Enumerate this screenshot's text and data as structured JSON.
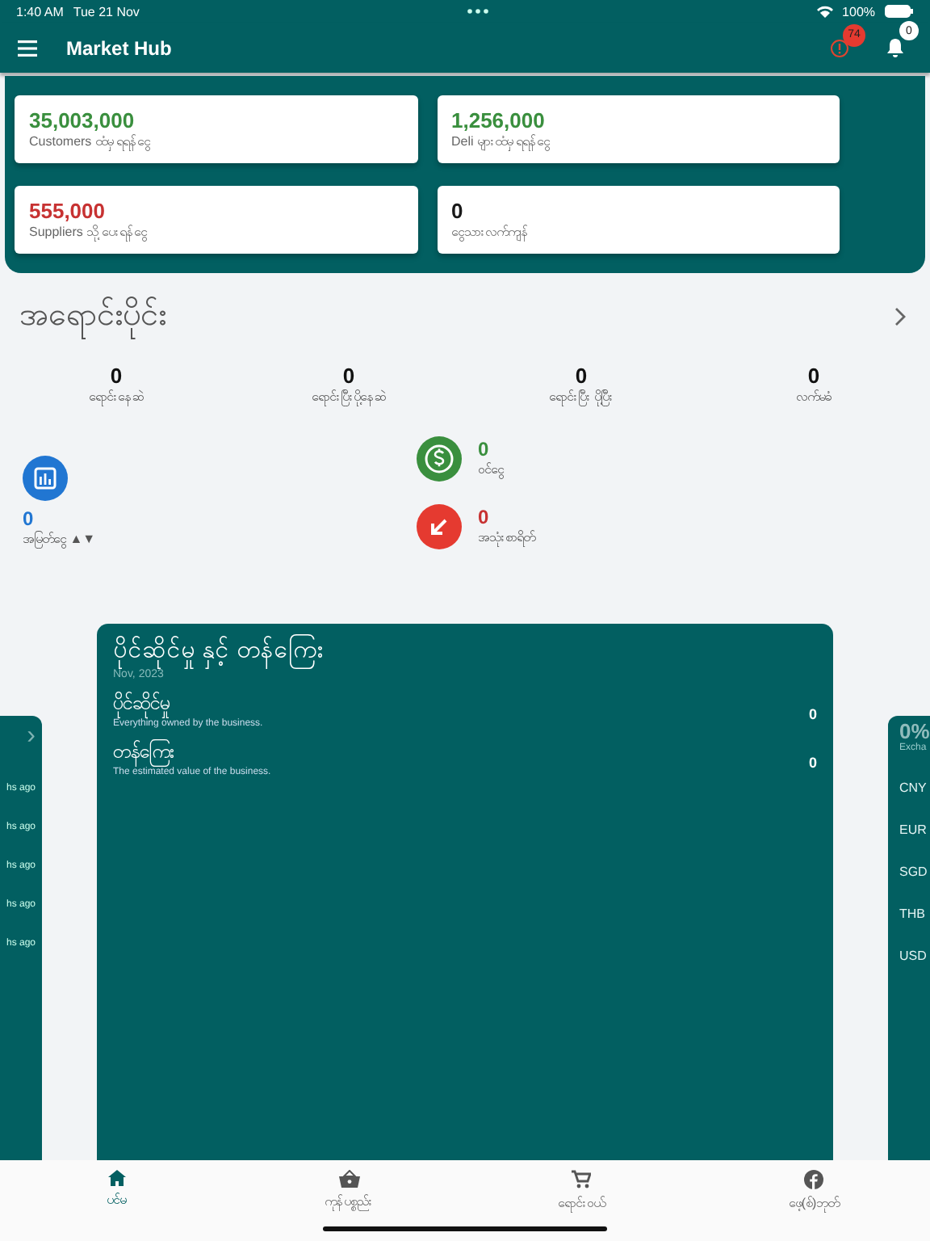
{
  "status_bar": {
    "time": "1:40 AM",
    "date": "Tue 21 Nov",
    "battery": "100%"
  },
  "app_bar": {
    "title": "Market Hub",
    "alert_count": "74",
    "notification_count": "0"
  },
  "summary_cards": [
    {
      "amount": "35,003,000",
      "label": "Customers ထံမှ ရရန်ငွေ",
      "color": "#3a8f3e"
    },
    {
      "amount": "1,256,000",
      "label": "Deli များထံမှ ရရန်ငွေ",
      "color": "#3a8f3e"
    },
    {
      "amount": "555,000",
      "label": "Suppliers သို့ ပေးရန်ငွေ",
      "color": "#c73232"
    },
    {
      "amount": "0",
      "label": "ငွေသားလက်ကျန်",
      "color": "#1a1a1a"
    }
  ],
  "sales": {
    "title": "အရောင်းပိုင်း",
    "order_stats": [
      {
        "value": "0",
        "label": "ရောင်းနေဆဲ"
      },
      {
        "value": "0",
        "label": "ရောင်းပြီးပို့နေဆဲ"
      },
      {
        "value": "0",
        "label": "ရောင်းပြီး ပို့ပြီး"
      },
      {
        "value": "0",
        "label": "လက်မခံ"
      }
    ],
    "profit": {
      "value": "0",
      "label": "အမြတ်ငွေ ▲▼"
    },
    "income": {
      "value": "0",
      "label": "ဝင်ငွေ"
    },
    "expense": {
      "value": "0",
      "label": "အသုံးစာရိတ်"
    }
  },
  "carousel": {
    "left_card": {
      "chevron": "›",
      "items": [
        "hs ago",
        "hs ago",
        "hs ago",
        "hs ago",
        "hs ago"
      ]
    },
    "main_card": {
      "title": "ပိုင်ဆိုင်မှု နှင့် တန်ကြေး",
      "date": "Nov, 2023",
      "rows": [
        {
          "name": "ပိုင်ဆိုင်မှု",
          "description": "Everything owned by the business.",
          "value": "0"
        },
        {
          "name": "တန်ကြေး",
          "description": "The estimated value of the business.",
          "value": "0"
        }
      ]
    },
    "right_card": {
      "percent": "0%",
      "caption": "Excha",
      "currencies": [
        "CNY",
        "EUR",
        "SGD",
        "THB",
        "USD"
      ]
    }
  },
  "bottom_nav": [
    {
      "label": "ပင်မ",
      "selected": true
    },
    {
      "label": "ကုန်ပစ္စည်း",
      "selected": false
    },
    {
      "label": "ရောင်းဝယ်",
      "selected": false
    },
    {
      "label": "ဖေ့(စ်)ဘုတ်",
      "selected": false
    }
  ]
}
